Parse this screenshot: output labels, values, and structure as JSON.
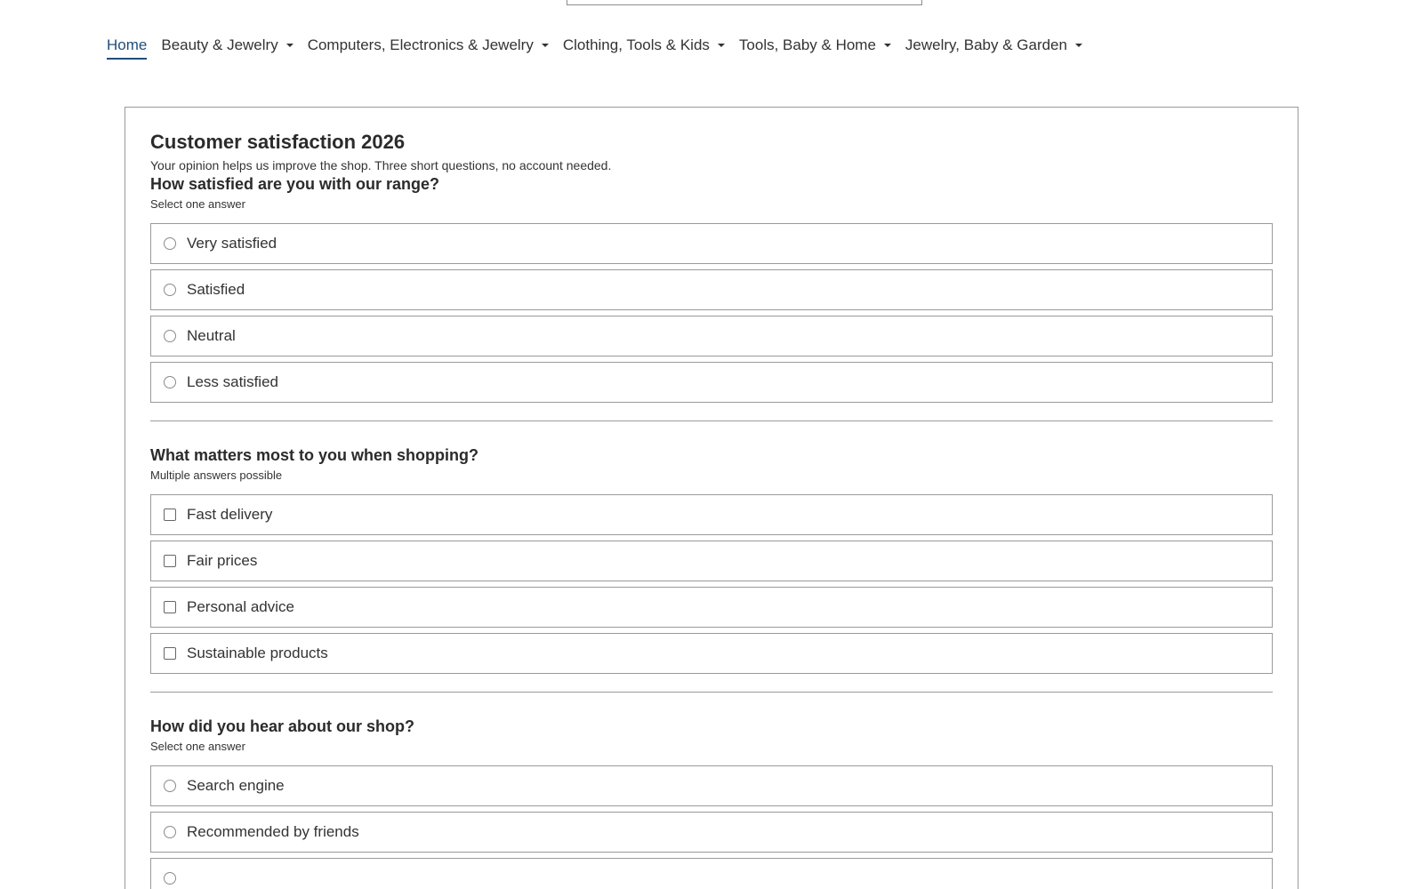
{
  "nav": {
    "items": [
      {
        "label": "Home",
        "active": true,
        "has_dropdown": false
      },
      {
        "label": "Beauty & Jewelry",
        "active": false,
        "has_dropdown": true
      },
      {
        "label": "Computers, Electronics & Jewelry",
        "active": false,
        "has_dropdown": true
      },
      {
        "label": "Clothing, Tools & Kids",
        "active": false,
        "has_dropdown": true
      },
      {
        "label": "Tools, Baby & Home",
        "active": false,
        "has_dropdown": true
      },
      {
        "label": "Jewelry, Baby & Garden",
        "active": false,
        "has_dropdown": true
      }
    ]
  },
  "survey": {
    "title": "Customer satisfaction 2026",
    "intro": "Your opinion helps us improve the shop. Three short questions, no account needed.",
    "questions": [
      {
        "text": "How satisfied are you with our range?",
        "hint": "Select one answer",
        "type": "radio",
        "options": [
          "Very satisfied",
          "Satisfied",
          "Neutral",
          "Less satisfied"
        ]
      },
      {
        "text": "What matters most to you when shopping?",
        "hint": "Multiple answers possible",
        "type": "checkbox",
        "options": [
          "Fast delivery",
          "Fair prices",
          "Personal advice",
          "Sustainable products"
        ]
      },
      {
        "text": "How did you hear about our shop?",
        "hint": "Select one answer",
        "type": "radio",
        "options": [
          "Search engine",
          "Recommended by friends",
          ""
        ]
      }
    ]
  },
  "colors": {
    "accent": "#1f4e79",
    "border": "#9a9a9a",
    "text": "#333333"
  }
}
